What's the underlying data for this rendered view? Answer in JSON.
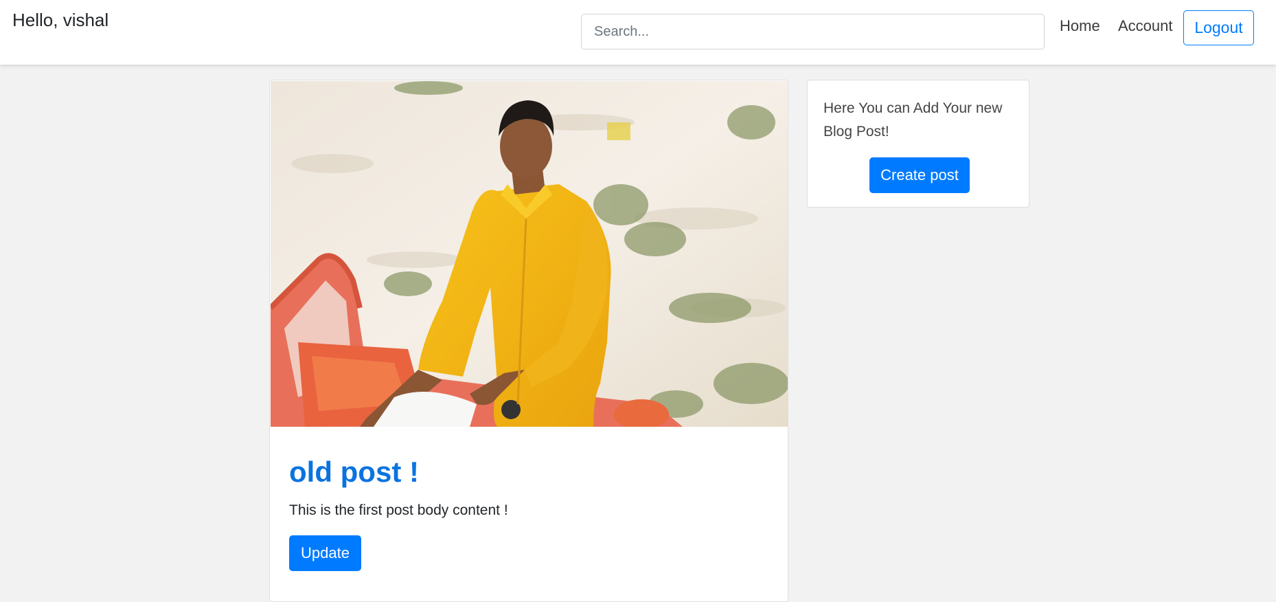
{
  "header": {
    "greeting": "Hello, vishal",
    "search_placeholder": "Search...",
    "nav": {
      "home": "Home",
      "account": "Account"
    },
    "logout_label": "Logout"
  },
  "post": {
    "image_alt": "Young man in a yellow shirt sitting on an orange boat",
    "title": "old post !",
    "body": "This is the first post body content !",
    "update_label": "Update"
  },
  "sidebar": {
    "text": "Here You can Add Your new Blog Post!",
    "create_label": "Create post"
  },
  "colors": {
    "primary": "#007bff",
    "title": "#0a73e0",
    "background": "#f2f2f2"
  }
}
